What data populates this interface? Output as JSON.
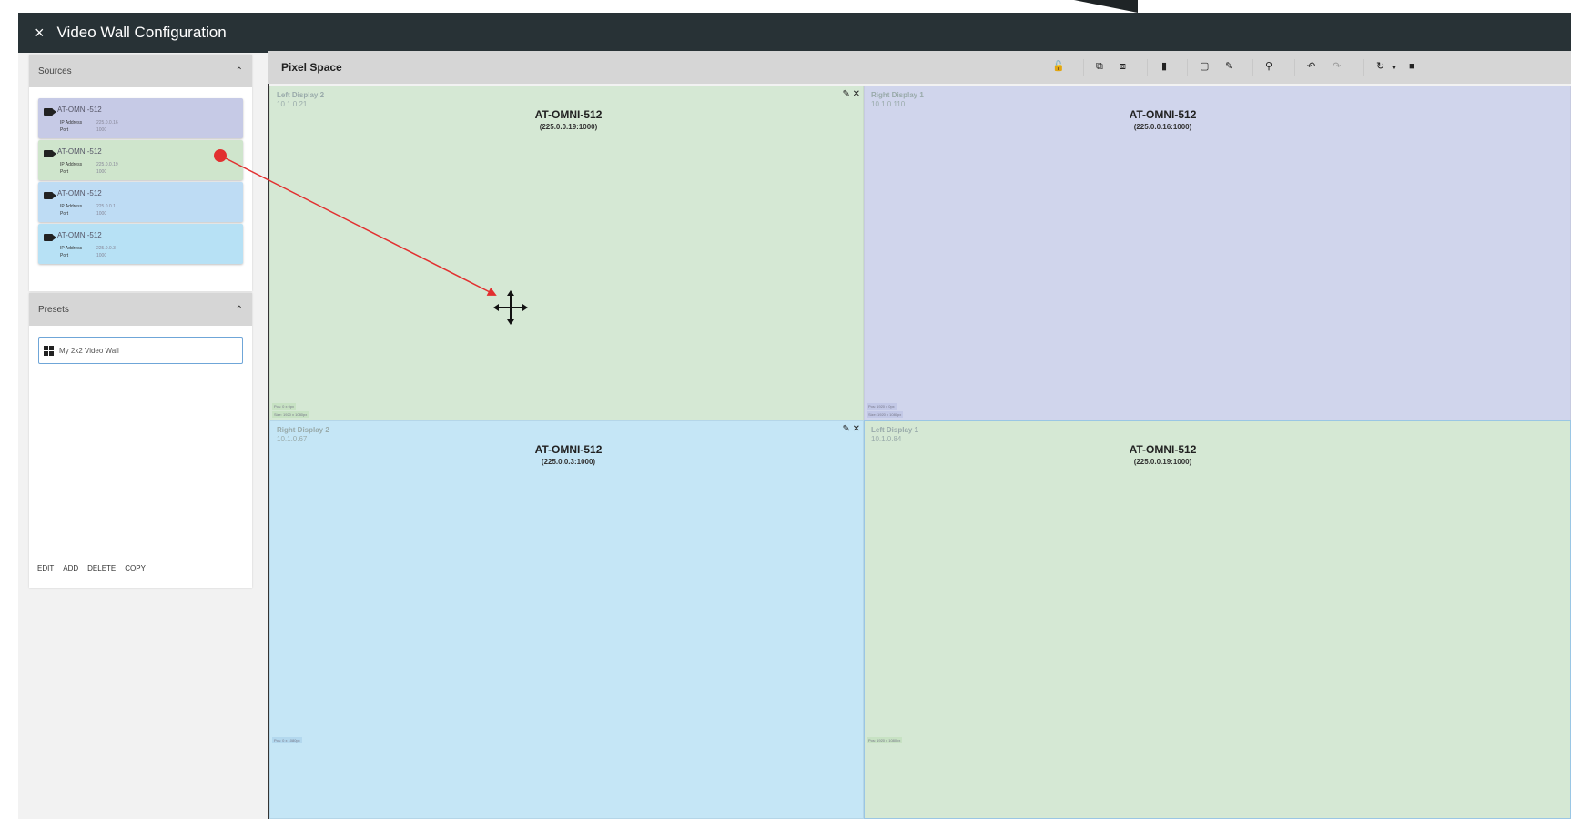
{
  "window": {
    "title": "Video Wall Configuration",
    "close_icon": "×"
  },
  "sources": {
    "header": "Sources",
    "items": [
      {
        "name": "AT-OMNI-512",
        "ip_label": "IP Address",
        "ip": "225.0.0.16",
        "port_label": "Port",
        "port": "1000",
        "color": "#c6cae6"
      },
      {
        "name": "AT-OMNI-512",
        "ip_label": "IP Address",
        "ip": "225.0.0.19",
        "port_label": "Port",
        "port": "1000",
        "color": "#cfe5cc"
      },
      {
        "name": "AT-OMNI-512",
        "ip_label": "IP Address",
        "ip": "225.0.0.1",
        "port_label": "Port",
        "port": "1000",
        "color": "#bedcf4"
      },
      {
        "name": "AT-OMNI-512",
        "ip_label": "IP Address",
        "ip": "225.0.0.3",
        "port_label": "Port",
        "port": "1000",
        "color": "#b7e1f5"
      }
    ]
  },
  "presets": {
    "header": "Presets",
    "item": "My 2x2 Video Wall",
    "actions": {
      "edit": "EDIT",
      "add": "ADD",
      "delete": "DELETE",
      "copy": "COPY"
    }
  },
  "pixel_space": {
    "title": "Pixel Space",
    "toolbar_icons": [
      "lock-icon",
      "bring-forward-icon",
      "send-backward-icon",
      "delete-icon",
      "display-icon",
      "edit-icon",
      "zoom-icon",
      "undo-icon",
      "redo-icon",
      "sync-icon",
      "dropdown-icon",
      "save-icon"
    ]
  },
  "displays": [
    {
      "name": "Left Display 2",
      "ip": "10.1.0.21",
      "source": "AT-OMNI-512",
      "address": "(225.0.0.19:1000)",
      "pos": "Pos: 0 x 0px",
      "size": "Size: 1920 x 1080px"
    },
    {
      "name": "Right Display 1",
      "ip": "10.1.0.110",
      "source": "AT-OMNI-512",
      "address": "(225.0.0.16:1000)",
      "pos": "Pos: 1920 x 0px",
      "size": "Size: 1920 x 1080px"
    },
    {
      "name": "Right Display 2",
      "ip": "10.1.0.67",
      "source": "AT-OMNI-512",
      "address": "(225.0.0.3:1000)",
      "pos": "Pos: 0 x 1080px"
    },
    {
      "name": "Left Display 1",
      "ip": "10.1.0.84",
      "source": "AT-OMNI-512",
      "address": "(225.0.0.19:1000)",
      "pos": "Pos: 1920 x 1080px"
    }
  ],
  "colors": {
    "titlebar": "#283236",
    "annotation_arrow": "#e23030"
  }
}
